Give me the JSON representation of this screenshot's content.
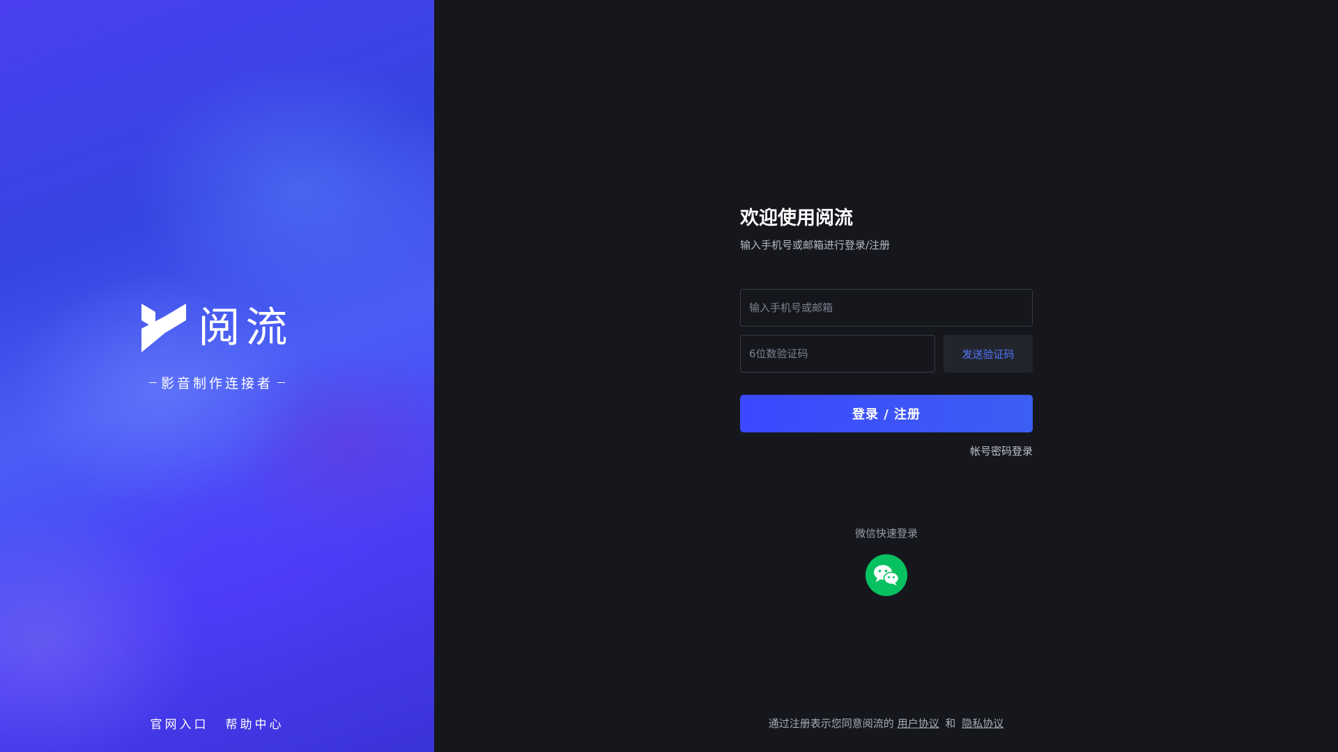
{
  "brand": {
    "app_name": "阅流",
    "slogan": "影音制作连接者",
    "links": [
      "官网入口",
      "帮助中心"
    ]
  },
  "form": {
    "title": "欢迎使用阅流",
    "subtitle": "输入手机号或邮箱进行登录/注册",
    "account_placeholder": "输入手机号或邮箱",
    "code_placeholder": "6位数验证码",
    "send_code_label": "发送验证码",
    "submit_label": "登录 / 注册",
    "password_login_label": "帐号密码登录"
  },
  "wechat": {
    "label": "微信快速登录",
    "icon": "wechat-icon"
  },
  "agreement": {
    "prefix": "通过注册表示您同意阅流的",
    "user_agreement": "用户协议",
    "conjunction": "和",
    "privacy_policy": "隐私协议"
  },
  "colors": {
    "primary": "#3a48ff",
    "link_blue": "#5277ff",
    "wechat_green": "#07c160",
    "panel_bg": "#16171d"
  }
}
